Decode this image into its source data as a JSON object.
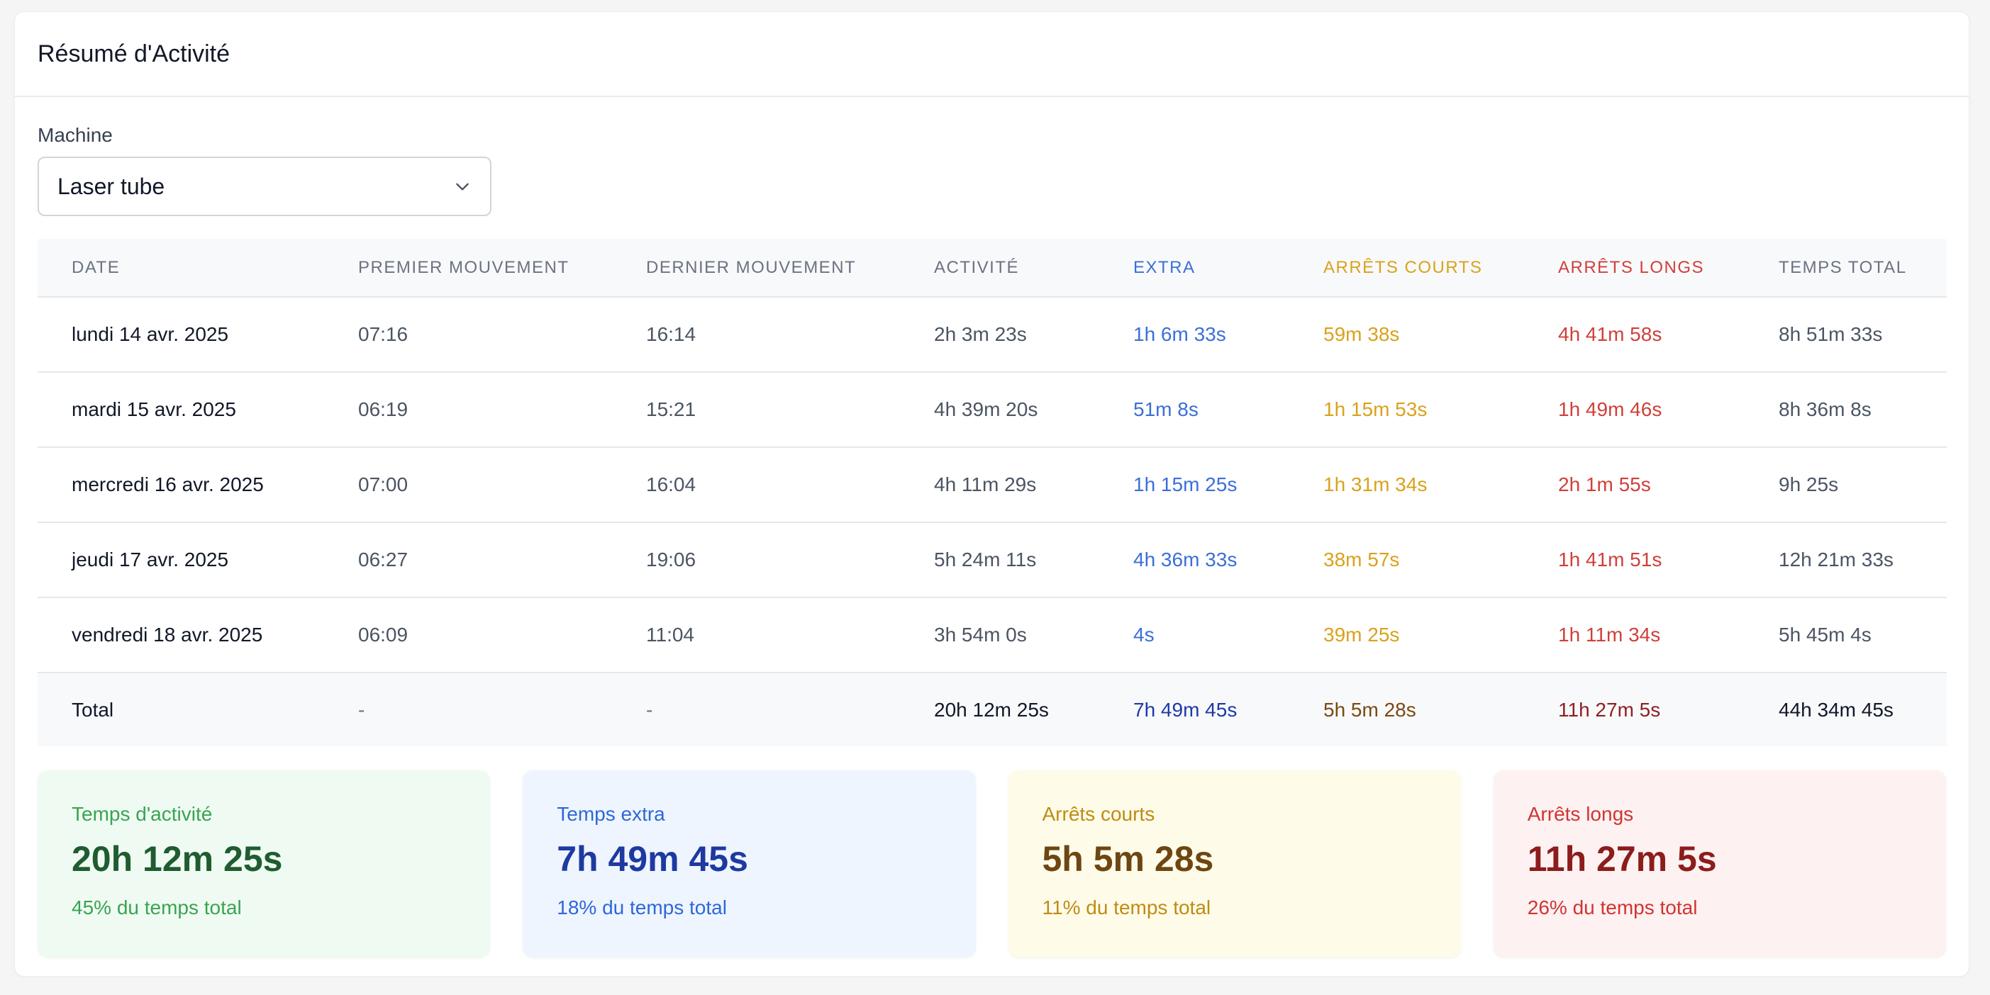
{
  "title": "Résumé d'Activité",
  "machine": {
    "label": "Machine",
    "selected": "Laser tube",
    "icon": "chevron-down-icon"
  },
  "table": {
    "headers": [
      "DATE",
      "PREMIER MOUVEMENT",
      "DERNIER MOUVEMENT",
      "ACTIVITÉ",
      "EXTRA",
      "ARRÊTS COURTS",
      "ARRÊTS LONGS",
      "TEMPS TOTAL"
    ],
    "rows": [
      [
        "lundi 14 avr. 2025",
        "07:16",
        "16:14",
        "2h 3m 23s",
        "1h 6m 33s",
        "59m 38s",
        "4h 41m 58s",
        "8h 51m 33s"
      ],
      [
        "mardi 15 avr. 2025",
        "06:19",
        "15:21",
        "4h 39m 20s",
        "51m 8s",
        "1h 15m 53s",
        "1h 49m 46s",
        "8h 36m 8s"
      ],
      [
        "mercredi 16 avr. 2025",
        "07:00",
        "16:04",
        "4h 11m 29s",
        "1h 15m 25s",
        "1h 31m 34s",
        "2h 1m 55s",
        "9h 25s"
      ],
      [
        "jeudi 17 avr. 2025",
        "06:27",
        "19:06",
        "5h 24m 11s",
        "4h 36m 33s",
        "38m 57s",
        "1h 41m 51s",
        "12h 21m 33s"
      ],
      [
        "vendredi 18 avr. 2025",
        "06:09",
        "11:04",
        "3h 54m 0s",
        "4s",
        "39m 25s",
        "1h 11m 34s",
        "5h 45m 4s"
      ]
    ],
    "total": [
      "Total",
      "-",
      "-",
      "20h 12m 25s",
      "7h 49m 45s",
      "5h 5m 28s",
      "11h 27m 5s",
      "44h 34m 45s"
    ]
  },
  "stats": [
    {
      "label": "Temps d'activité",
      "value": "20h 12m 25s",
      "pct": "45% du temps total"
    },
    {
      "label": "Temps extra",
      "value": "7h 49m 45s",
      "pct": "18% du temps total"
    },
    {
      "label": "Arrêts courts",
      "value": "5h 5m 28s",
      "pct": "11% du temps total"
    },
    {
      "label": "Arrêts longs",
      "value": "11h 27m 5s",
      "pct": "26% du temps total"
    }
  ],
  "colors": {
    "extra": "#3b6fd8",
    "arrets_courts": "#d9a21b",
    "arrets_longs": "#d0403a",
    "activite": "#3aa352"
  }
}
